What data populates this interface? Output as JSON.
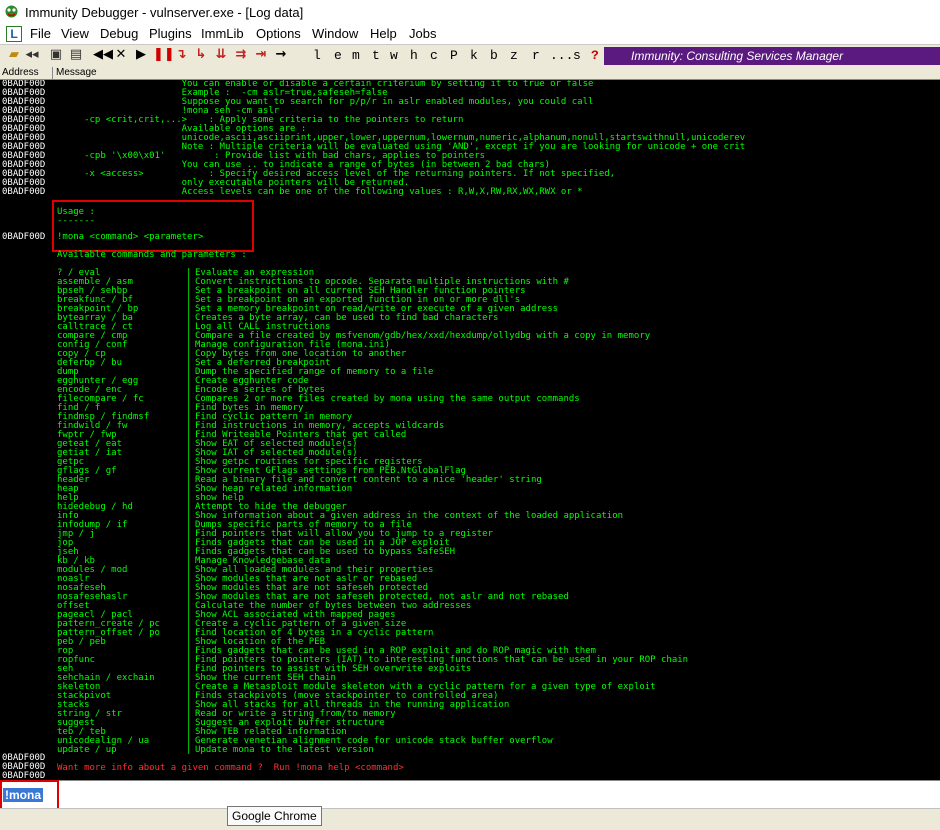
{
  "window": {
    "title": "Immunity Debugger - vulnserver.exe - [Log data]"
  },
  "menu": [
    "File",
    "View",
    "Debug",
    "Plugins",
    "ImmLib",
    "Options",
    "Window",
    "Help",
    "Jobs"
  ],
  "toolbar": {
    "letters": [
      "l",
      "e",
      "m",
      "t",
      "w",
      "h",
      "c",
      "P",
      "k",
      "b",
      "z",
      "r",
      "...",
      "s",
      "?"
    ],
    "banner": "Immunity: Consulting Services Manager"
  },
  "columns": {
    "address": "Address",
    "message": "Message"
  },
  "log": {
    "addr": "0BADF00D",
    "head_lines": [
      {
        "addr": "0BADF00D",
        "text": "                       You can enable or disable a certain criterium by setting it to true or false"
      },
      {
        "addr": "0BADF00D",
        "text": "                       Example :  -cm aslr=true,safeseh=false"
      },
      {
        "addr": "0BADF00D",
        "text": "                       Suppose you want to search for p/p/r in aslr enabled modules, you could call"
      },
      {
        "addr": "0BADF00D",
        "text": "                       !mona seh -cm aslr"
      },
      {
        "addr": "0BADF00D",
        "text": "     -cp <crit,crit,...>    : Apply some criteria to the pointers to return"
      },
      {
        "addr": "0BADF00D",
        "text": "                       Available options are :"
      },
      {
        "addr": "0BADF00D",
        "text": "                       unicode,ascii,asciiprint,upper,lower,uppernum,lowernum,numeric,alphanum,nonull,startswithnull,unicoderev"
      },
      {
        "addr": "0BADF00D",
        "text": "                       Note : Multiple criteria will be evaluated using 'AND', except if you are looking for unicode + one crit"
      },
      {
        "addr": "0BADF00D",
        "text": "     -cpb '\\x00\\x01'         : Provide list with bad chars, applies to pointers"
      },
      {
        "addr": "0BADF00D",
        "text": "                       You can use .. to indicate a range of bytes (in between 2 bad chars)"
      },
      {
        "addr": "0BADF00D",
        "text": "     -x <access>            : Specify desired access level of the returning pointers. If not specified,"
      },
      {
        "addr": "0BADF00D",
        "text": "                       only executable pointers will be returned."
      },
      {
        "addr": "0BADF00D",
        "text": "                       Access levels can be one of the following values : R,W,X,RW,RX,WX,RWX or *"
      }
    ],
    "usage": {
      "label": "Usage :",
      "underline": "-------",
      "syntax": "!mona <command> <parameter>",
      "addr": "0BADF00D"
    },
    "available_label": "Available commands and parameters :",
    "commands": [
      {
        "cmd": "? / eval",
        "desc": "Evaluate an expression"
      },
      {
        "cmd": "assemble / asm",
        "desc": "Convert instructions to opcode. Separate multiple instructions with #"
      },
      {
        "cmd": "bpseh / sehbp",
        "desc": "Set a breakpoint on all current SEH Handler function pointers"
      },
      {
        "cmd": "breakfunc / bf",
        "desc": "Set a breakpoint on an exported function in on or more dll's"
      },
      {
        "cmd": "breakpoint / bp",
        "desc": "Set a memory breakpoint on read/write or execute of a given address"
      },
      {
        "cmd": "bytearray / ba",
        "desc": "Creates a byte array, can be used to find bad characters"
      },
      {
        "cmd": "calltrace / ct",
        "desc": "Log all CALL instructions"
      },
      {
        "cmd": "compare / cmp",
        "desc": "Compare a file created by msfvenom/gdb/hex/xxd/hexdump/ollydbg with a copy in memory"
      },
      {
        "cmd": "config / conf",
        "desc": "Manage configuration file (mona.ini)"
      },
      {
        "cmd": "copy / cp",
        "desc": "Copy bytes from one location to another"
      },
      {
        "cmd": "deferbp / bu",
        "desc": "Set a deferred breakpoint"
      },
      {
        "cmd": "dump",
        "desc": "Dump the specified range of memory to a file"
      },
      {
        "cmd": "egghunter / egg",
        "desc": "Create egghunter code"
      },
      {
        "cmd": "encode / enc",
        "desc": "Encode a series of bytes"
      },
      {
        "cmd": "filecompare / fc",
        "desc": "Compares 2 or more files created by mona using the same output commands"
      },
      {
        "cmd": "find / f",
        "desc": "Find bytes in memory"
      },
      {
        "cmd": "findmsp / findmsf",
        "desc": "Find cyclic pattern in memory"
      },
      {
        "cmd": "findwild / fw",
        "desc": "Find instructions in memory, accepts wildcards"
      },
      {
        "cmd": "fwptr / fwp",
        "desc": "Find Writeable Pointers that get called"
      },
      {
        "cmd": "geteat / eat",
        "desc": "Show EAT of selected module(s)"
      },
      {
        "cmd": "getiat / iat",
        "desc": "Show IAT of selected module(s)"
      },
      {
        "cmd": "getpc",
        "desc": "Show getpc routines for specific registers"
      },
      {
        "cmd": "gflags / gf",
        "desc": "Show current GFlags settings from PEB.NtGlobalFlag"
      },
      {
        "cmd": "header",
        "desc": "Read a binary file and convert content to a nice 'header' string"
      },
      {
        "cmd": "heap",
        "desc": "Show heap related information"
      },
      {
        "cmd": "help",
        "desc": "show help"
      },
      {
        "cmd": "hidedebug / hd",
        "desc": "Attempt to hide the debugger"
      },
      {
        "cmd": "info",
        "desc": "Show information about a given address in the context of the loaded application"
      },
      {
        "cmd": "infodump / if",
        "desc": "Dumps specific parts of memory to a file"
      },
      {
        "cmd": "jmp / j",
        "desc": "Find pointers that will allow you to jump to a register"
      },
      {
        "cmd": "jop",
        "desc": "Finds gadgets that can be used in a JOP exploit"
      },
      {
        "cmd": "jseh",
        "desc": "Finds gadgets that can be used to bypass SafeSEH"
      },
      {
        "cmd": "kb / kb",
        "desc": "Manage Knowledgebase data"
      },
      {
        "cmd": "modules / mod",
        "desc": "Show all loaded modules and their properties"
      },
      {
        "cmd": "noaslr",
        "desc": "Show modules that are not aslr or rebased"
      },
      {
        "cmd": "nosafeseh",
        "desc": "Show modules that are not safeseh protected"
      },
      {
        "cmd": "nosafesehaslr",
        "desc": "Show modules that are not safeseh protected, not aslr and not rebased"
      },
      {
        "cmd": "offset",
        "desc": "Calculate the number of bytes between two addresses"
      },
      {
        "cmd": "pageacl / pacl",
        "desc": "Show ACL associated with mapped pages"
      },
      {
        "cmd": "pattern_create / pc",
        "desc": "Create a cyclic pattern of a given size"
      },
      {
        "cmd": "pattern_offset / po",
        "desc": "Find location of 4 bytes in a cyclic pattern"
      },
      {
        "cmd": "peb / peb",
        "desc": "Show location of the PEB"
      },
      {
        "cmd": "rop",
        "desc": "Finds gadgets that can be used in a ROP exploit and do ROP magic with them"
      },
      {
        "cmd": "ropfunc",
        "desc": "Find pointers to pointers (IAT) to interesting functions that can be used in your ROP chain"
      },
      {
        "cmd": "seh",
        "desc": "Find pointers to assist with SEH overwrite exploits"
      },
      {
        "cmd": "sehchain / exchain",
        "desc": "Show the current SEH chain"
      },
      {
        "cmd": "skeleton",
        "desc": "Create a Metasploit module skeleton with a cyclic pattern for a given type of exploit"
      },
      {
        "cmd": "stackpivot",
        "desc": "Finds stackpivots (move stackpointer to controlled area)"
      },
      {
        "cmd": "stacks",
        "desc": "Show all stacks for all threads in the running application"
      },
      {
        "cmd": "string / str",
        "desc": "Read or write a string from/to memory"
      },
      {
        "cmd": "suggest",
        "desc": "Suggest an exploit buffer structure"
      },
      {
        "cmd": "teb / teb",
        "desc": "Show TEB related information"
      },
      {
        "cmd": "unicodealign / ua",
        "desc": "Generate venetian alignment code for unicode stack buffer overflow"
      },
      {
        "cmd": "update / up",
        "desc": "Update mona to the latest version"
      }
    ],
    "trailer_addrs": [
      "0BADF00D",
      "0BADF00D",
      "0BADF00D"
    ],
    "more_info": "Want more info about a given command ?  Run !mona help <command>"
  },
  "command_bar": {
    "value": "!mona"
  },
  "tooltip": "Google Chrome",
  "colors": {
    "log_bg": "#000000",
    "log_text": "#00ff00",
    "addr_text": "#ffffff",
    "more_info": "#ff3030",
    "banner": "#5b1a7f",
    "highlight": "#e00000"
  }
}
